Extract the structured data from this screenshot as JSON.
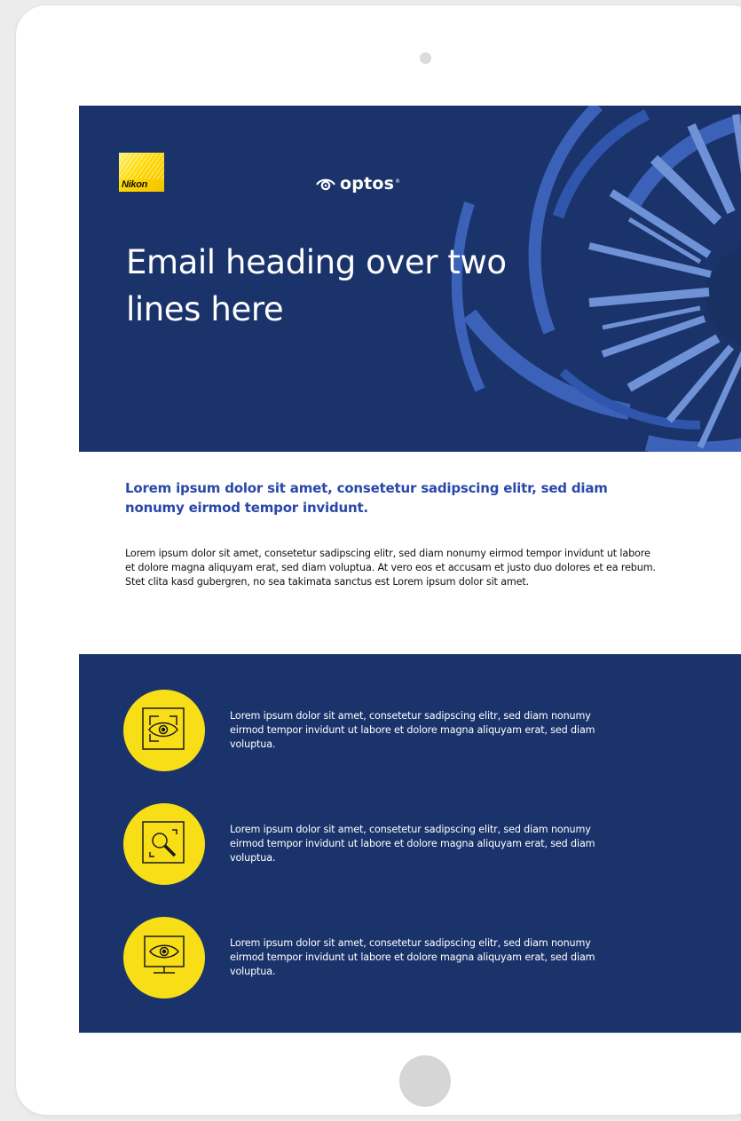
{
  "brand": {
    "nikon_wordmark": "Nikon",
    "optos_wordmark": "optos",
    "optos_registered": "®"
  },
  "hero": {
    "heading": "Email heading over two lines here"
  },
  "intro": {
    "lead": "Lorem ipsum dolor sit amet, consetetur sadipscing elitr, sed diam nonumy eirmod tempor invidunt.",
    "body": "Lorem ipsum dolor sit amet, consetetur sadipscing elitr, sed diam nonumy eirmod tempor invidunt ut labore et dolore magna aliquyam erat, sed diam voluptua. At vero eos et accusam et justo duo dolores et ea rebum. Stet clita kasd gubergren, no sea takimata sanctus est Lorem ipsum dolor sit amet."
  },
  "features": [
    {
      "icon": "eye-scan-icon",
      "text": "Lorem ipsum dolor sit amet, consetetur sadipscing elitr, sed diam nonumy eirmod tempor invidunt ut labore et dolore magna aliquyam erat, sed diam voluptua."
    },
    {
      "icon": "magnifier-scan-icon",
      "text": "Lorem ipsum dolor sit amet, consetetur sadipscing elitr, sed diam nonumy eirmod tempor invidunt ut labore et dolore magna aliquyam erat, sed diam voluptua."
    },
    {
      "icon": "eye-monitor-icon",
      "text": "Lorem ipsum dolor sit amet, consetetur sadipscing elitr, sed diam nonumy eirmod tempor invidunt ut labore et dolore magna aliquyam erat, sed diam voluptua."
    }
  ],
  "colors": {
    "navy": "#1b336b",
    "accent_blue": "#2948a9",
    "art_blue": "#3b62b8",
    "art_light_blue": "#6f92d6",
    "icon_yellow": "#f8de17",
    "device_frame": "#ffffff"
  }
}
